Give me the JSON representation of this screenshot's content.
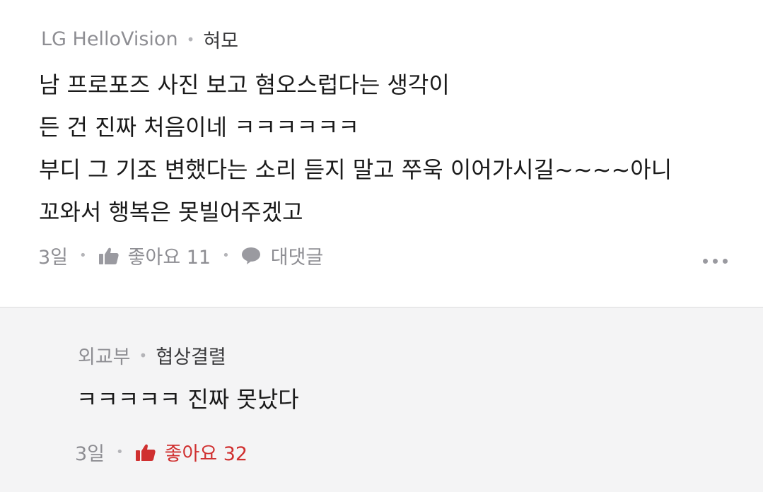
{
  "comment": {
    "org": "LG HelloVision",
    "nickname": "혀모",
    "lines": [
      "남 프로포즈 사진 보고 혐오스럽다는 생각이",
      "든 건 진짜 처음이네 ㅋㅋㅋㅋㅋㅋ",
      "부디 그 기조 변했다는 소리 듣지 말고 쭈욱 이어가시길~~~~아니",
      "꼬와서 행복은 못빌어주겠고"
    ],
    "time": "3일",
    "like_label": "좋아요 11",
    "reply_label": "대댓글",
    "more_icon": "more-horizontal-icon"
  },
  "reply": {
    "org": "외교부",
    "nickname": "협상결렬",
    "lines": [
      "ㅋㅋㅋㅋㅋ 진짜 못났다"
    ],
    "time": "3일",
    "like_label": "좋아요 32"
  },
  "colors": {
    "accent_red": "#d03030",
    "muted_gray": "#8e8e93",
    "reply_bg": "#f4f4f5"
  }
}
